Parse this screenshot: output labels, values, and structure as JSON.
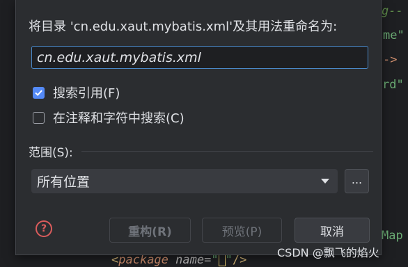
{
  "editor": {
    "line1": "g--",
    "line2": "me\"",
    "line3": "->",
    "line4": "rd\"",
    "line5": "Map",
    "line6_open": "<",
    "line6_kw": "package",
    "line6_attr": " name=",
    "line6_q1": "\"",
    "line6_q2": "\"",
    "line6_close": "/>"
  },
  "dialog": {
    "title": "将目录 'cn.edu.xaut.mybatis.xml'及其用法重命名为:",
    "input_value": "cn.edu.xaut.mybatis.xml",
    "search_refs_label": "搜索引用(F)",
    "search_refs_checked": true,
    "search_comments_label": "在注释和字符中搜索(C)",
    "search_comments_checked": false,
    "scope_label": "范围(S):",
    "scope_value": "所有位置",
    "more_label": "...",
    "help_icon": "?",
    "refactor_label": "重构(R)",
    "preview_label": "预览(P)",
    "cancel_label": "取消"
  },
  "watermark": "CSDN @飘飞的焰火",
  "colors": {
    "accent": "#548af7",
    "focus_border": "#4a88c7",
    "help_red": "#db5c5c"
  }
}
